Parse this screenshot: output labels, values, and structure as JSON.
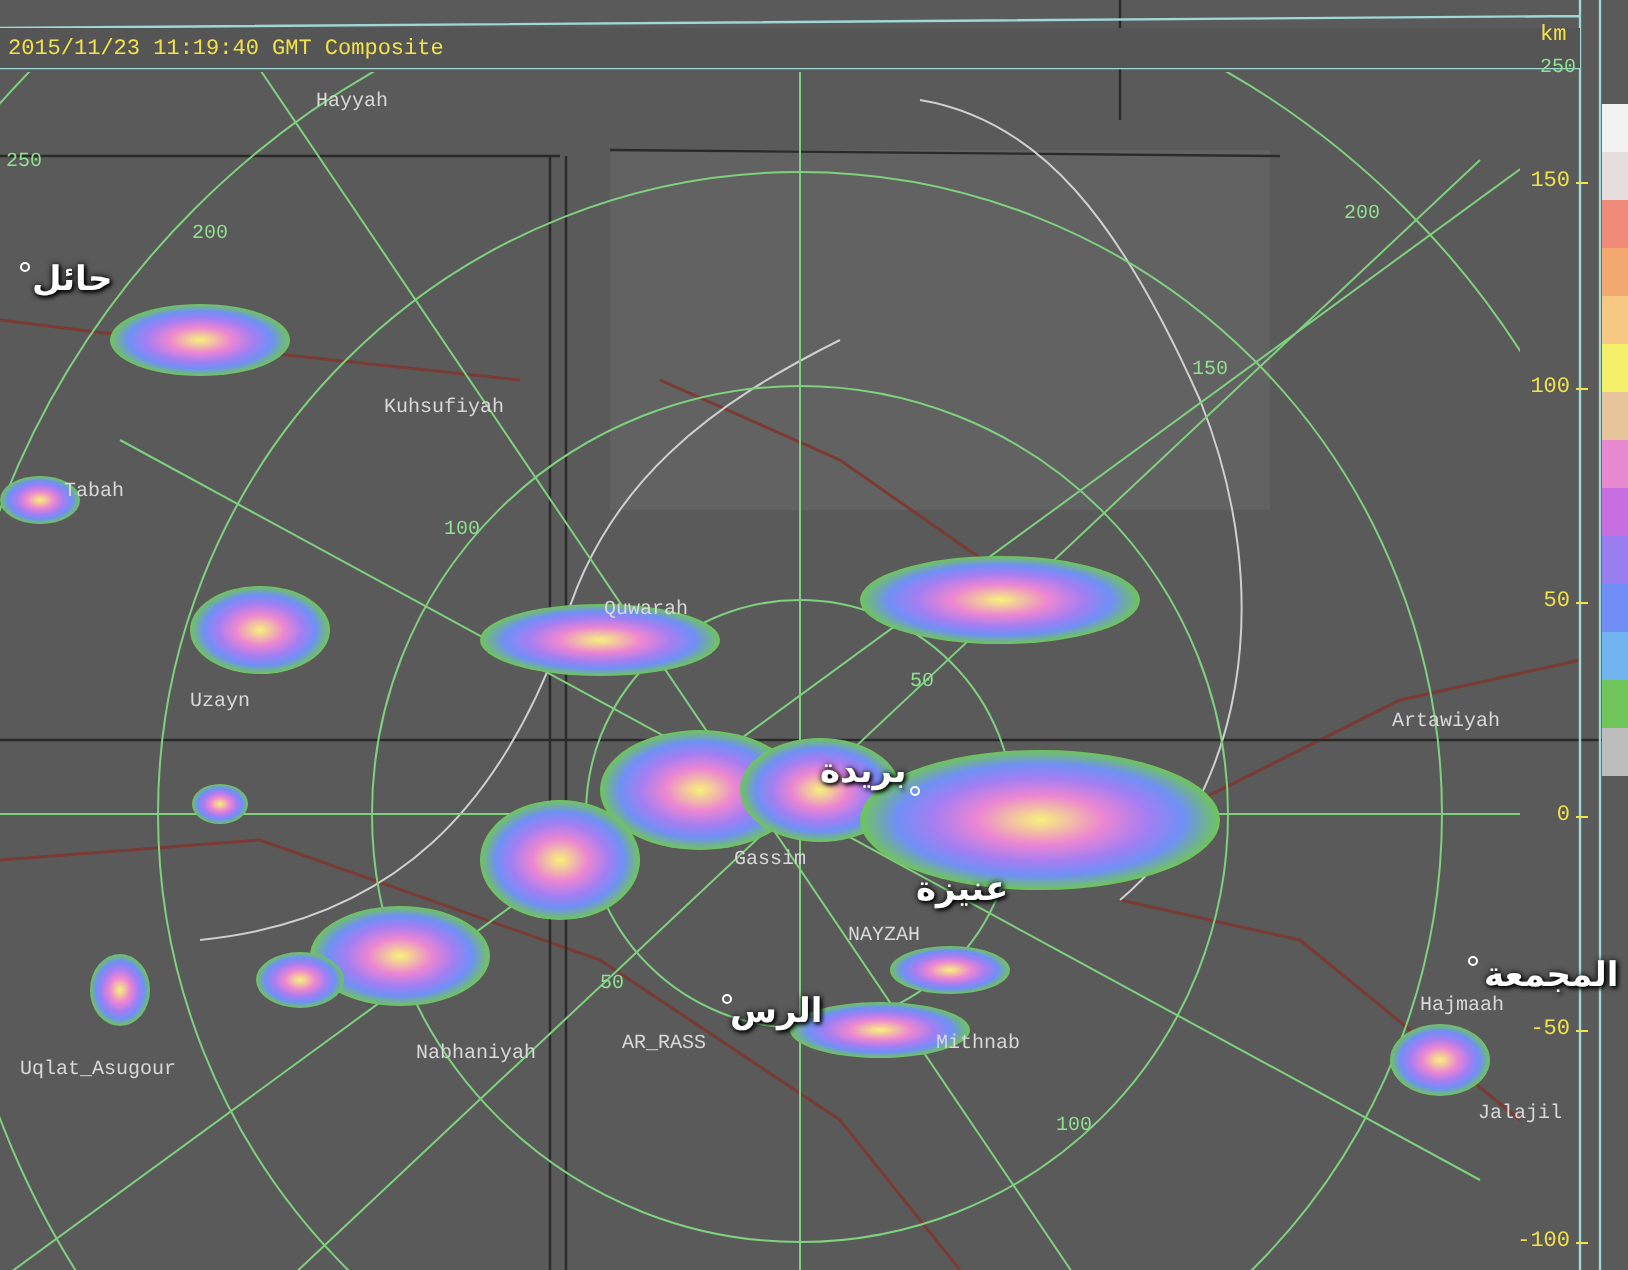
{
  "header": {
    "timestamp": "2015/11/23 11:19:40 GMT Composite",
    "unit": "km"
  },
  "axis_ticks": [
    "150",
    "100",
    "50",
    "0",
    "-50",
    "-100"
  ],
  "range_labels": [
    "250",
    "200",
    "100",
    "50",
    "50",
    "150",
    "200",
    "250",
    "100"
  ],
  "places": [
    {
      "name": "Hayyah",
      "kind": "latin"
    },
    {
      "name": "حائل",
      "kind": "arabic"
    },
    {
      "name": "Kuhsufiyah",
      "kind": "latin"
    },
    {
      "name": "Tabah",
      "kind": "latin"
    },
    {
      "name": "Quwarah",
      "kind": "latin"
    },
    {
      "name": "Uzayn",
      "kind": "latin"
    },
    {
      "name": "Artawiyah",
      "kind": "latin"
    },
    {
      "name": "بريدة",
      "kind": "arabic"
    },
    {
      "name": "Gassim",
      "kind": "latin"
    },
    {
      "name": "عنيزة",
      "kind": "arabic"
    },
    {
      "name": "NAYZAH",
      "kind": "latin"
    },
    {
      "name": "المجمعة",
      "kind": "arabic"
    },
    {
      "name": "الرس",
      "kind": "arabic"
    },
    {
      "name": "Hajmaah",
      "kind": "latin"
    },
    {
      "name": "AR_RASS",
      "kind": "latin"
    },
    {
      "name": "Mithnab",
      "kind": "latin"
    },
    {
      "name": "Nabhaniyah",
      "kind": "latin"
    },
    {
      "name": "Uqlat_Asugour",
      "kind": "latin"
    },
    {
      "name": "Jalajil",
      "kind": "latin"
    }
  ],
  "legend": [
    {
      "color": "#f2f2f2"
    },
    {
      "color": "#e6dede"
    },
    {
      "color": "#f08a78"
    },
    {
      "color": "#f3a870"
    },
    {
      "color": "#f6c884"
    },
    {
      "color": "#f5f06a"
    },
    {
      "color": "#e8c49a"
    },
    {
      "color": "#e88ad0"
    },
    {
      "color": "#c86ee0"
    },
    {
      "color": "#9a7ef0"
    },
    {
      "color": "#6f8df5"
    },
    {
      "color": "#72b4f0"
    },
    {
      "color": "#6fc55a"
    },
    {
      "color": "#bdbdbd"
    }
  ]
}
